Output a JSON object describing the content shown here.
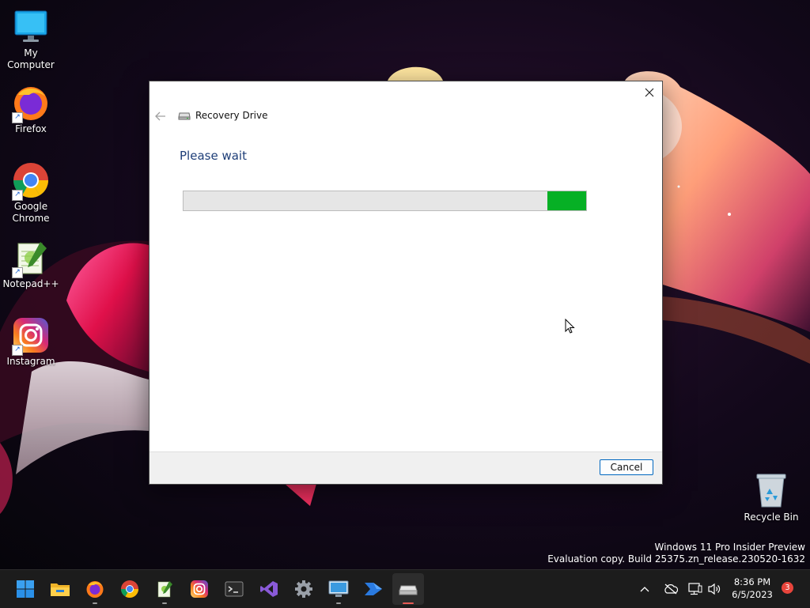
{
  "desktop": {
    "icons": [
      {
        "label": "My Computer"
      },
      {
        "label": "Firefox"
      },
      {
        "label": "Google Chrome"
      },
      {
        "label": "Notepad++"
      },
      {
        "label": "Instagram"
      },
      {
        "label": "Recycle Bin"
      }
    ],
    "watermark": {
      "line1": "Windows 11 Pro Insider Preview",
      "line2": "Evaluation copy. Build 25375.zn_release.230520-1632"
    }
  },
  "dialog": {
    "title": "Recovery Drive",
    "heading": "Please wait",
    "progress_indeterminate": true,
    "cancel_label": "Cancel"
  },
  "taskbar": {
    "time": "8:36 PM",
    "date": "6/5/2023",
    "notification_count": "3",
    "apps": [
      "start",
      "file-explorer",
      "firefox",
      "chrome",
      "notepad-plus-plus",
      "instagram",
      "terminal",
      "visual-studio",
      "settings",
      "remote-desktop",
      "power-automate",
      "recovery-drive"
    ]
  },
  "colors": {
    "progress_fill": "#06b025",
    "heading": "#1e3e78",
    "accent": "#0067c0"
  }
}
